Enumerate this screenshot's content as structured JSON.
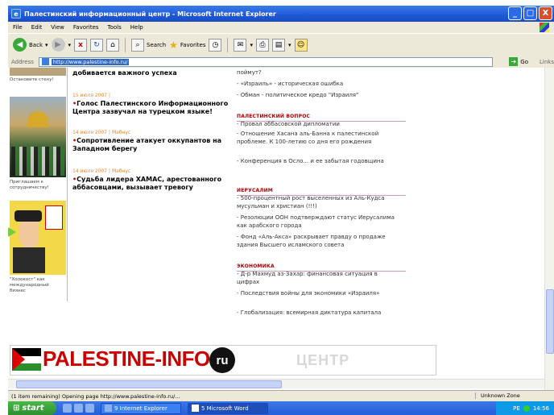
{
  "window": {
    "title": "Палестинский информационный центр - Microsoft Internet Explorer",
    "ie_icon": "e",
    "min": "_",
    "max": "□",
    "close": "X"
  },
  "menu": [
    "File",
    "Edit",
    "View",
    "Favorites",
    "Tools",
    "Help"
  ],
  "toolbar": {
    "back": "Back",
    "back_arrow": "◀",
    "fwd_arrow": "▶",
    "stop": "x",
    "refresh": "↻",
    "home": "⌂",
    "search": "Search",
    "favorites": "Favorites",
    "mail": "✉",
    "print": "⎙",
    "edit": "▤",
    "messenger": "☺",
    "history": "◷",
    "dropdown": "▾"
  },
  "address": {
    "label": "Address",
    "url": "http://www.palestine-info.ru/",
    "go": "Go",
    "go_arrow": "➔",
    "links": "Links"
  },
  "left": {
    "caption1": "Остановите стену!",
    "caption2": "Приглашаем к сотрудничеству!",
    "caption3": "\"Холокост\" как международный бизнес"
  },
  "news": [
    {
      "meta": "",
      "title": "добивается важного успеха"
    },
    {
      "meta": "15 июля 2007 |",
      "title": "Голос Палестинского Информационного Центра зазвучал на турецком языке!"
    },
    {
      "meta": "14 июля 2007 | Мабнус",
      "title": "Сопротивление атакует оккупантов на Западном берегу"
    },
    {
      "meta": "14 июля 2007 | Мабнус",
      "title": "Судьба лидера ХАМАС, арестованного аббасовцами, вызывает тревогу"
    }
  ],
  "right": {
    "top": [
      "поймут?",
      "- «Израиль» - историческая ошибка",
      "- Обман - политическое кредо \"Израиля\""
    ],
    "sections": [
      {
        "head": "ПАЛЕСТИНСКИЙ ВОПРОС",
        "items": [
          "- Провал аббасовской дипломатии",
          "- Отношение Хасана аль-Банна к палестинской проблеме. К 100-летию со дня его рождения",
          "- Конференция в Осло... и ее забытая годовщина"
        ]
      },
      {
        "head": "ИЕРУСАЛИМ",
        "items": [
          "- 500-процентный рост выселенных из Аль-Кудса мусульман и христиан (!!!)",
          "- Резолюции ООН подтверждают статус Иерусалима как арабского города",
          "- Фонд «Аль-Акса» раскрывает правду о продаже здания Высшего исламского совета"
        ]
      },
      {
        "head": "ЭКОНОМИКА",
        "items": [
          "- Д-р Махмуд аз-Захар: финансовая ситуация в цифрах",
          "- Последствия войны для экономики «Израиля»",
          "- Глобализация: всемирная диктатура капитала"
        ]
      }
    ]
  },
  "banner": {
    "logo": "PALESTINE-INFO.",
    "ru": "ru",
    "centr": "ЦЕНТР"
  },
  "status": {
    "text": "(1 item remaining) Opening page http://www.palestine-info.ru/...",
    "zone": "Unknown Zone"
  },
  "taskbar": {
    "start": "start",
    "task1": "9 Internet Explorer",
    "task2": "5 Microsoft Word",
    "lang": "РЕ",
    "clock": "14:56"
  }
}
